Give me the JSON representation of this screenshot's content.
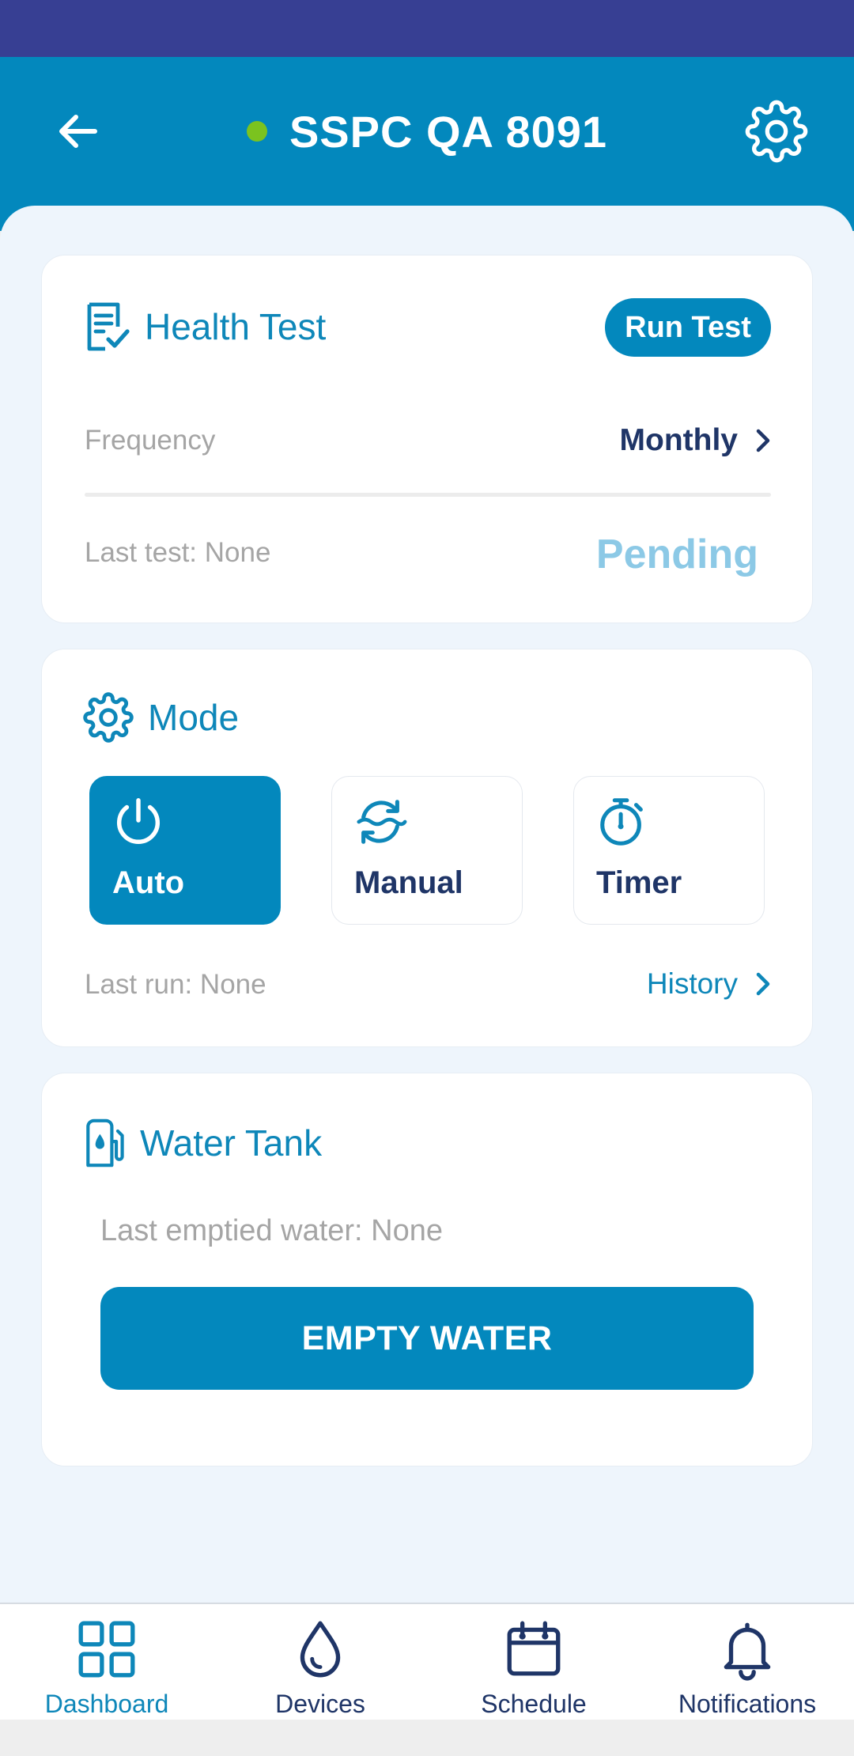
{
  "header": {
    "title": "SSPC QA 8091",
    "status": "online"
  },
  "health_test": {
    "title": "Health Test",
    "run_button": "Run Test",
    "frequency_label": "Frequency",
    "frequency_value": "Monthly",
    "last_test": "Last test: None",
    "status": "Pending"
  },
  "mode": {
    "title": "Mode",
    "options": [
      {
        "label": "Auto",
        "selected": true,
        "icon": "power-icon"
      },
      {
        "label": "Manual",
        "selected": false,
        "icon": "sync-water-icon"
      },
      {
        "label": "Timer",
        "selected": false,
        "icon": "stopwatch-icon"
      }
    ],
    "last_run": "Last run: None",
    "history_link": "History"
  },
  "water_tank": {
    "title": "Water Tank",
    "last_emptied": "Last emptied water: None",
    "empty_button": "EMPTY WATER"
  },
  "bottom_nav": [
    {
      "label": "Dashboard",
      "active": true,
      "icon": "grid-icon"
    },
    {
      "label": "Devices",
      "active": false,
      "icon": "water-drop-icon"
    },
    {
      "label": "Schedule",
      "active": false,
      "icon": "calendar-icon"
    },
    {
      "label": "Notifications",
      "active": false,
      "icon": "bell-icon"
    }
  ],
  "colors": {
    "primary": "#0388bd",
    "status_bar": "#373f93",
    "online": "#7bc31f",
    "pending": "#8cc9e6",
    "dark_text": "#1f3567",
    "background": "#eef5fc"
  }
}
